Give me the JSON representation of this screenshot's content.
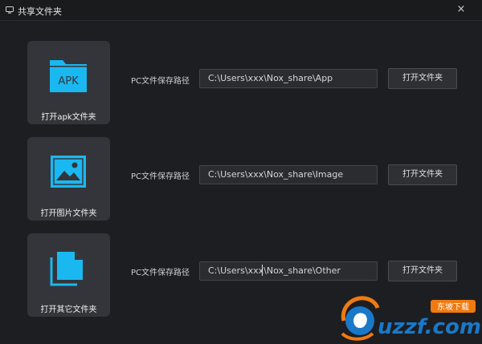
{
  "window": {
    "title": "共享文件夹",
    "close_symbol": "×"
  },
  "rows": [
    {
      "card_label": "打开apk文件夹",
      "icon": "apk-folder-icon",
      "icon_text": "APK",
      "path_label": "PC文件保存路径",
      "path_value": "C:\\Users\\xxx\\Nox_share\\App",
      "button_label": "打开文件夹"
    },
    {
      "card_label": "打开图片文件夹",
      "icon": "image-icon",
      "path_label": "PC文件保存路径",
      "path_value": "C:\\Users\\xxx\\Nox_share\\Image",
      "button_label": "打开文件夹"
    },
    {
      "card_label": "打开其它文件夹",
      "icon": "documents-icon",
      "path_label": "PC文件保存路径",
      "path_value": "C:\\Users\\xxx\\Nox_share\\Other",
      "button_label": "打开文件夹"
    }
  ],
  "watermark": {
    "text": "uzzf.com",
    "badge_text": "东坡下载"
  },
  "colors": {
    "accent": "#1ab8f0",
    "background": "#1d1e21",
    "card": "#34353a",
    "watermark_orange": "#f07a10",
    "watermark_blue": "#1a78c8"
  }
}
